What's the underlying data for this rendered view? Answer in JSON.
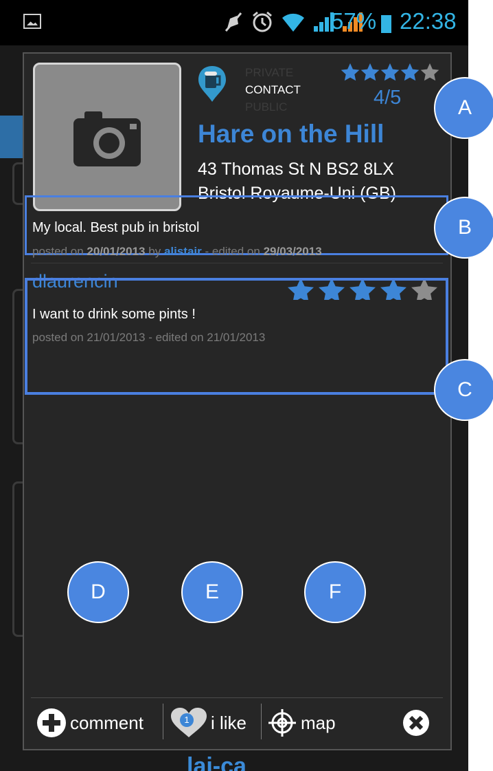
{
  "status_bar": {
    "battery_percent": "57%",
    "time": "22:38",
    "icons": [
      "gallery-notification-icon",
      "mute-icon",
      "alarm-icon",
      "wifi-icon",
      "signal-icon",
      "signal-roaming-icon",
      "battery-icon"
    ]
  },
  "place": {
    "photo_icon": "camera-icon",
    "category_icon": "beer-mug-icon",
    "privacy_options": [
      "PRIVATE",
      "CONTACT",
      "PUBLIC"
    ],
    "privacy_selected": "CONTACT",
    "rating_stars": 4,
    "rating_max": 5,
    "rating_text": "4/5",
    "name": "Hare on the Hill",
    "address_line1": "43 Thomas St N BS2 8LX",
    "address_line2": "Bristol Royaume-Uni (GB)"
  },
  "comments": [
    {
      "text": "My local. Best pub in bristol",
      "meta_posted_prefix": "posted on",
      "posted_date": "20/01/2013",
      "by_word": "by",
      "author": "alistair",
      "meta_edited_prefix": "- edited on",
      "edited_date": "29/03/2013"
    },
    {
      "author": "dlaurencin",
      "rating_stars": 4,
      "rating_max": 5,
      "text": "I want to drink some pints !",
      "meta": "posted on 21/01/2013 - edited on 21/01/2013"
    }
  ],
  "toolbar": {
    "comment_label": "comment",
    "like_label": "i like",
    "like_count": "1",
    "map_label": "map",
    "close_icon": "close-icon"
  },
  "background": {
    "peek_text": "lai-ca"
  },
  "callouts": [
    "A",
    "B",
    "C",
    "D",
    "E",
    "F"
  ],
  "colors": {
    "accent_blue": "#3d86d6",
    "callout_blue": "#4a86e0",
    "status_blue": "#33b5e5",
    "dialog_bg": "#262626"
  }
}
